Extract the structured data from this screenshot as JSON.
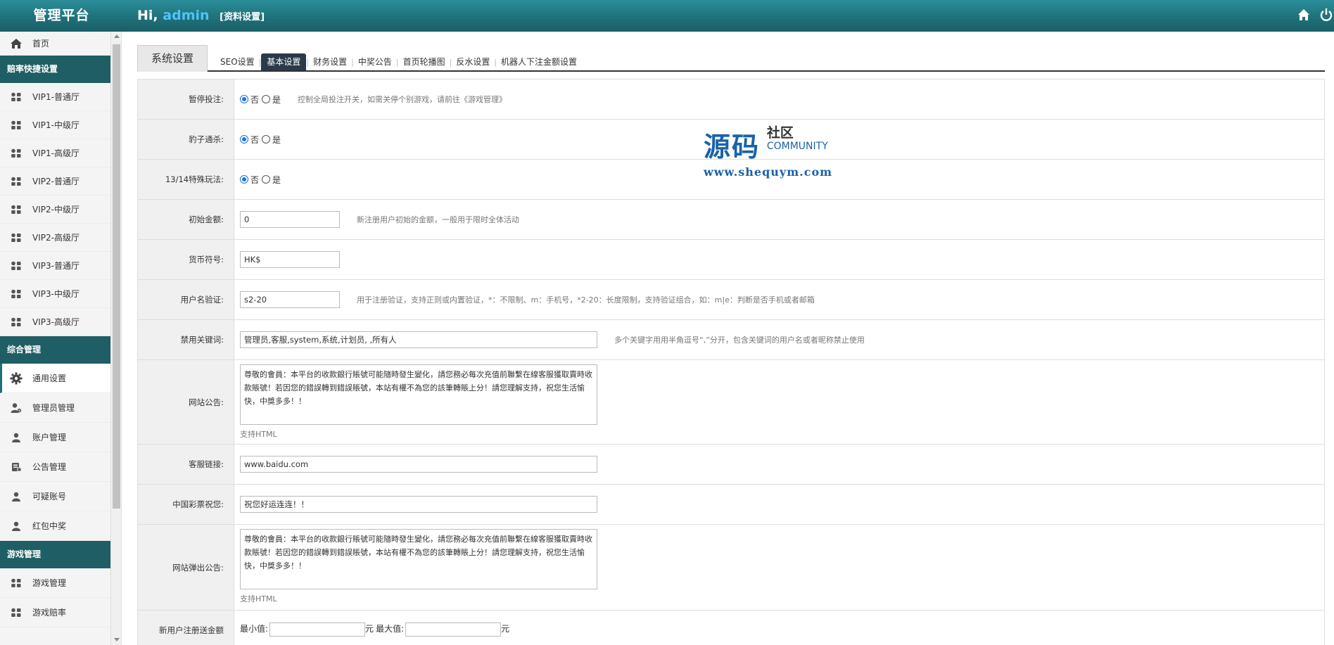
{
  "header": {
    "brand": "管理平台",
    "greeting_prefix": "Hi,",
    "username": "admin",
    "profile_link": "[资料设置]",
    "icons": [
      "home-icon",
      "power-icon"
    ]
  },
  "sidebar": {
    "items": [
      {
        "type": "item",
        "label": "首页",
        "icon": "home-icon"
      },
      {
        "type": "head",
        "label": "赔率快捷设置"
      },
      {
        "type": "item",
        "label": "VIP1-普通厅",
        "icon": "grid-icon"
      },
      {
        "type": "item",
        "label": "VIP1-中级厅",
        "icon": "grid-icon"
      },
      {
        "type": "item",
        "label": "VIP1-高级厅",
        "icon": "grid-icon"
      },
      {
        "type": "item",
        "label": "VIP2-普通厅",
        "icon": "grid-icon"
      },
      {
        "type": "item",
        "label": "VIP2-中级厅",
        "icon": "grid-icon"
      },
      {
        "type": "item",
        "label": "VIP2-高级厅",
        "icon": "grid-icon"
      },
      {
        "type": "item",
        "label": "VIP3-普通厅",
        "icon": "grid-icon"
      },
      {
        "type": "item",
        "label": "VIP3-中级厅",
        "icon": "grid-icon"
      },
      {
        "type": "item",
        "label": "VIP3-高级厅",
        "icon": "grid-icon"
      },
      {
        "type": "head",
        "label": "综合管理"
      },
      {
        "type": "item",
        "label": "通用设置",
        "icon": "gear-icon",
        "active": true
      },
      {
        "type": "item",
        "label": "管理员管理",
        "icon": "admin-user-icon"
      },
      {
        "type": "item",
        "label": "账户管理",
        "icon": "user-icon"
      },
      {
        "type": "item",
        "label": "公告管理",
        "icon": "notice-icon"
      },
      {
        "type": "item",
        "label": "可疑账号",
        "icon": "user-icon"
      },
      {
        "type": "item",
        "label": "红包中奖",
        "icon": "user-icon"
      },
      {
        "type": "head",
        "label": "游戏管理"
      },
      {
        "type": "item",
        "label": "游戏管理",
        "icon": "grid-icon"
      },
      {
        "type": "item",
        "label": "游戏赔率",
        "icon": "grid-icon"
      }
    ]
  },
  "tabs": {
    "main": "系统设置",
    "sub": [
      {
        "label": "SEO设置"
      },
      {
        "label": "基本设置",
        "active": true
      },
      {
        "label": "财务设置"
      },
      {
        "label": "中奖公告"
      },
      {
        "label": "首页轮播图"
      },
      {
        "label": "反水设置"
      },
      {
        "label": "机器人下注金额设置"
      }
    ]
  },
  "form": {
    "pause_bet": {
      "label": "暂停投注:",
      "no": "否",
      "yes": "是",
      "selected": "否",
      "hint": "控制全局投注开关，如需关停个别游戏，请前往《游戏管理》"
    },
    "leopard": {
      "label": "豹子通杀:",
      "no": "否",
      "yes": "是",
      "selected": "否"
    },
    "special": {
      "label": "13/14特殊玩法:",
      "no": "否",
      "yes": "是",
      "selected": "否"
    },
    "initial_amount": {
      "label": "初始金额:",
      "value": "0",
      "hint": "新注册用户初始的金额，一般用于限时全体活动"
    },
    "currency": {
      "label": "货币符号:",
      "value": "HK$"
    },
    "username_check": {
      "label": "用户名验证:",
      "value": "s2-20",
      "hint": "用于注册验证，支持正则或内置验证，*：不限制、m：手机号，*2-20：长度限制，支持验证组合，如：m|e：判断是否手机或者邮箱"
    },
    "banned_words": {
      "label": "禁用关键词:",
      "value": "管理员,客服,system,系统,计划员, ,所有人",
      "hint": "多个关键字用用半角逗号“,”分开，包含关键词的用户名或者昵称禁止使用"
    },
    "site_notice": {
      "label": "网站公告:",
      "value": "尊敬的會員：本平台的收款銀行賬號可能隨時發生變化，請您務必每次充值前聯繫在線客服獲取賣時收款賬號！若因您的錯誤轉到錯誤賬號，本站有權不為您的該筆轉賬上分！請您理解支持，祝您生活愉快，中獎多多！！",
      "note": "支持HTML"
    },
    "service_link": {
      "label": "客服链接:",
      "value": "www.baidu.com"
    },
    "lottery_wish": {
      "label": "中国彩票祝您:",
      "value": "祝您好运连连！！"
    },
    "popup_notice": {
      "label": "网站弹出公告:",
      "value": "尊敬的會員：本平台的收款銀行賬號可能隨時發生變化，請您務必每次充值前聯繫在線客服獲取賣時收款賬號！若因您的錯誤轉到錯誤賬號，本站有權不為您的該筆轉賬上分！請您理解支持，祝您生活愉快，中獎多多！！",
      "note": "支持HTML"
    },
    "new_user_bonus": {
      "label": "新用户注册送金额",
      "min_label": "最小值:",
      "unit": "元",
      "max_label": "最大值:",
      "unit2": "元",
      "min_value": "",
      "max_value": ""
    }
  },
  "watermark": {
    "title": "源码",
    "cn": "社区",
    "en": "COMMUNITY",
    "url": "www.shequym.com"
  },
  "colors": {
    "header": "#1f6f78",
    "section_head": "#1f5e64",
    "active_tab": "#2b3a4a",
    "radio": "#1a73e8"
  }
}
